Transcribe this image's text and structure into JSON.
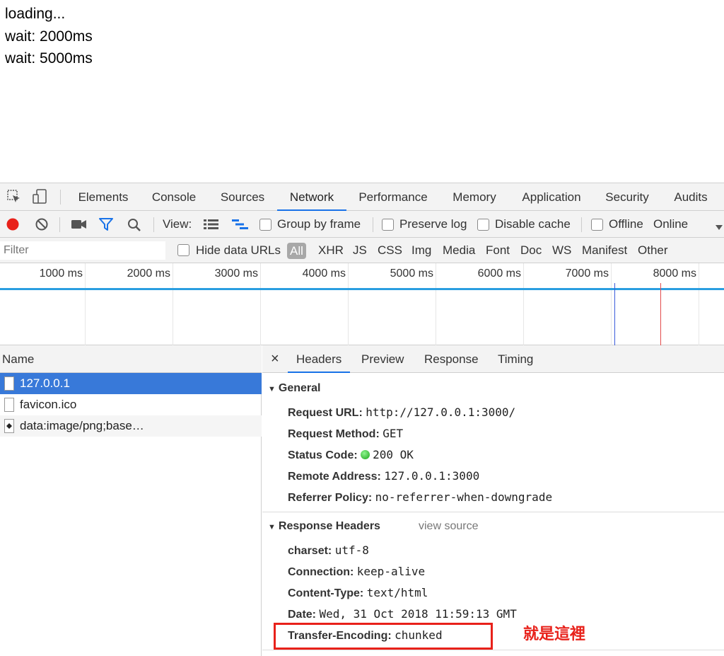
{
  "page": {
    "lines": [
      "loading...",
      "wait: 2000ms",
      "wait: 5000ms"
    ]
  },
  "devtools": {
    "tabs": [
      "Elements",
      "Console",
      "Sources",
      "Network",
      "Performance",
      "Memory",
      "Application",
      "Security",
      "Audits"
    ],
    "active_tab": "Network",
    "toolbar": {
      "view_label": "View:",
      "group_by_frame": "Group by frame",
      "preserve_log": "Preserve log",
      "disable_cache": "Disable cache",
      "offline": "Offline",
      "throttle": "Online"
    },
    "filter": {
      "placeholder": "Filter",
      "hide_data_urls": "Hide data URLs",
      "types": [
        "All",
        "XHR",
        "JS",
        "CSS",
        "Img",
        "Media",
        "Font",
        "Doc",
        "WS",
        "Manifest",
        "Other"
      ]
    },
    "timeline_ticks": [
      "1000 ms",
      "2000 ms",
      "3000 ms",
      "4000 ms",
      "5000 ms",
      "6000 ms",
      "7000 ms",
      "8000 ms"
    ],
    "requests": {
      "header": "Name",
      "items": [
        "127.0.0.1",
        "favicon.ico",
        "data:image/png;base…"
      ]
    },
    "detail": {
      "close": "×",
      "tabs": [
        "Headers",
        "Preview",
        "Response",
        "Timing"
      ],
      "general": {
        "title": "General",
        "request_url_k": "Request URL:",
        "request_url_v": "http://127.0.0.1:3000/",
        "method_k": "Request Method:",
        "method_v": "GET",
        "status_k": "Status Code:",
        "status_v": "200 OK",
        "remote_k": "Remote Address:",
        "remote_v": "127.0.0.1:3000",
        "referrer_k": "Referrer Policy:",
        "referrer_v": "no-referrer-when-downgrade"
      },
      "response_headers": {
        "title": "Response Headers",
        "view_source": "view source",
        "charset_k": "charset:",
        "charset_v": "utf-8",
        "connection_k": "Connection:",
        "connection_v": "keep-alive",
        "ctype_k": "Content-Type:",
        "ctype_v": "text/html",
        "date_k": "Date:",
        "date_v": "Wed, 31 Oct 2018 11:59:13 GMT",
        "te_k": "Transfer-Encoding:",
        "te_v": "chunked"
      }
    }
  },
  "annotation": "就是這裡",
  "colors": {
    "accent": "#1a73e8",
    "selection": "#3879d9",
    "annotation": "#e8211a",
    "record": "#e8211a"
  }
}
